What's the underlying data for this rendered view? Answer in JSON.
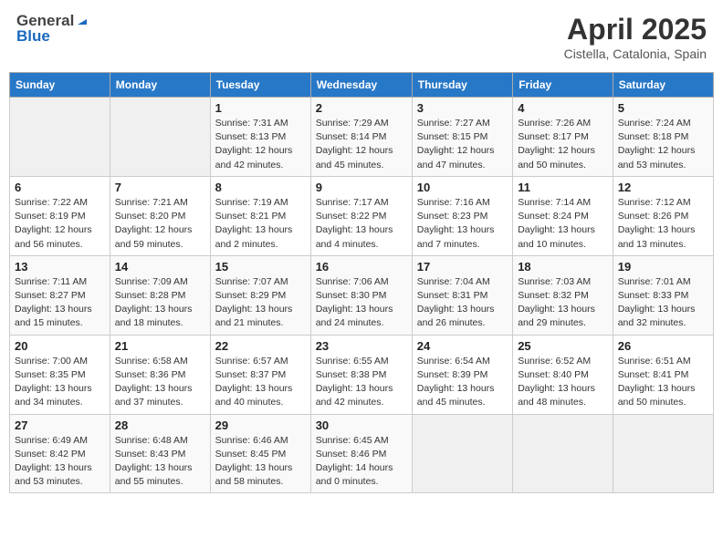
{
  "header": {
    "logo_general": "General",
    "logo_blue": "Blue",
    "title": "April 2025",
    "subtitle": "Cistella, Catalonia, Spain"
  },
  "weekdays": [
    "Sunday",
    "Monday",
    "Tuesday",
    "Wednesday",
    "Thursday",
    "Friday",
    "Saturday"
  ],
  "weeks": [
    [
      {
        "day": "",
        "sunrise": "",
        "sunset": "",
        "daylight": "",
        "empty": true
      },
      {
        "day": "",
        "sunrise": "",
        "sunset": "",
        "daylight": "",
        "empty": true
      },
      {
        "day": "1",
        "sunrise": "Sunrise: 7:31 AM",
        "sunset": "Sunset: 8:13 PM",
        "daylight": "Daylight: 12 hours and 42 minutes."
      },
      {
        "day": "2",
        "sunrise": "Sunrise: 7:29 AM",
        "sunset": "Sunset: 8:14 PM",
        "daylight": "Daylight: 12 hours and 45 minutes."
      },
      {
        "day": "3",
        "sunrise": "Sunrise: 7:27 AM",
        "sunset": "Sunset: 8:15 PM",
        "daylight": "Daylight: 12 hours and 47 minutes."
      },
      {
        "day": "4",
        "sunrise": "Sunrise: 7:26 AM",
        "sunset": "Sunset: 8:17 PM",
        "daylight": "Daylight: 12 hours and 50 minutes."
      },
      {
        "day": "5",
        "sunrise": "Sunrise: 7:24 AM",
        "sunset": "Sunset: 8:18 PM",
        "daylight": "Daylight: 12 hours and 53 minutes."
      }
    ],
    [
      {
        "day": "6",
        "sunrise": "Sunrise: 7:22 AM",
        "sunset": "Sunset: 8:19 PM",
        "daylight": "Daylight: 12 hours and 56 minutes."
      },
      {
        "day": "7",
        "sunrise": "Sunrise: 7:21 AM",
        "sunset": "Sunset: 8:20 PM",
        "daylight": "Daylight: 12 hours and 59 minutes."
      },
      {
        "day": "8",
        "sunrise": "Sunrise: 7:19 AM",
        "sunset": "Sunset: 8:21 PM",
        "daylight": "Daylight: 13 hours and 2 minutes."
      },
      {
        "day": "9",
        "sunrise": "Sunrise: 7:17 AM",
        "sunset": "Sunset: 8:22 PM",
        "daylight": "Daylight: 13 hours and 4 minutes."
      },
      {
        "day": "10",
        "sunrise": "Sunrise: 7:16 AM",
        "sunset": "Sunset: 8:23 PM",
        "daylight": "Daylight: 13 hours and 7 minutes."
      },
      {
        "day": "11",
        "sunrise": "Sunrise: 7:14 AM",
        "sunset": "Sunset: 8:24 PM",
        "daylight": "Daylight: 13 hours and 10 minutes."
      },
      {
        "day": "12",
        "sunrise": "Sunrise: 7:12 AM",
        "sunset": "Sunset: 8:26 PM",
        "daylight": "Daylight: 13 hours and 13 minutes."
      }
    ],
    [
      {
        "day": "13",
        "sunrise": "Sunrise: 7:11 AM",
        "sunset": "Sunset: 8:27 PM",
        "daylight": "Daylight: 13 hours and 15 minutes."
      },
      {
        "day": "14",
        "sunrise": "Sunrise: 7:09 AM",
        "sunset": "Sunset: 8:28 PM",
        "daylight": "Daylight: 13 hours and 18 minutes."
      },
      {
        "day": "15",
        "sunrise": "Sunrise: 7:07 AM",
        "sunset": "Sunset: 8:29 PM",
        "daylight": "Daylight: 13 hours and 21 minutes."
      },
      {
        "day": "16",
        "sunrise": "Sunrise: 7:06 AM",
        "sunset": "Sunset: 8:30 PM",
        "daylight": "Daylight: 13 hours and 24 minutes."
      },
      {
        "day": "17",
        "sunrise": "Sunrise: 7:04 AM",
        "sunset": "Sunset: 8:31 PM",
        "daylight": "Daylight: 13 hours and 26 minutes."
      },
      {
        "day": "18",
        "sunrise": "Sunrise: 7:03 AM",
        "sunset": "Sunset: 8:32 PM",
        "daylight": "Daylight: 13 hours and 29 minutes."
      },
      {
        "day": "19",
        "sunrise": "Sunrise: 7:01 AM",
        "sunset": "Sunset: 8:33 PM",
        "daylight": "Daylight: 13 hours and 32 minutes."
      }
    ],
    [
      {
        "day": "20",
        "sunrise": "Sunrise: 7:00 AM",
        "sunset": "Sunset: 8:35 PM",
        "daylight": "Daylight: 13 hours and 34 minutes."
      },
      {
        "day": "21",
        "sunrise": "Sunrise: 6:58 AM",
        "sunset": "Sunset: 8:36 PM",
        "daylight": "Daylight: 13 hours and 37 minutes."
      },
      {
        "day": "22",
        "sunrise": "Sunrise: 6:57 AM",
        "sunset": "Sunset: 8:37 PM",
        "daylight": "Daylight: 13 hours and 40 minutes."
      },
      {
        "day": "23",
        "sunrise": "Sunrise: 6:55 AM",
        "sunset": "Sunset: 8:38 PM",
        "daylight": "Daylight: 13 hours and 42 minutes."
      },
      {
        "day": "24",
        "sunrise": "Sunrise: 6:54 AM",
        "sunset": "Sunset: 8:39 PM",
        "daylight": "Daylight: 13 hours and 45 minutes."
      },
      {
        "day": "25",
        "sunrise": "Sunrise: 6:52 AM",
        "sunset": "Sunset: 8:40 PM",
        "daylight": "Daylight: 13 hours and 48 minutes."
      },
      {
        "day": "26",
        "sunrise": "Sunrise: 6:51 AM",
        "sunset": "Sunset: 8:41 PM",
        "daylight": "Daylight: 13 hours and 50 minutes."
      }
    ],
    [
      {
        "day": "27",
        "sunrise": "Sunrise: 6:49 AM",
        "sunset": "Sunset: 8:42 PM",
        "daylight": "Daylight: 13 hours and 53 minutes."
      },
      {
        "day": "28",
        "sunrise": "Sunrise: 6:48 AM",
        "sunset": "Sunset: 8:43 PM",
        "daylight": "Daylight: 13 hours and 55 minutes."
      },
      {
        "day": "29",
        "sunrise": "Sunrise: 6:46 AM",
        "sunset": "Sunset: 8:45 PM",
        "daylight": "Daylight: 13 hours and 58 minutes."
      },
      {
        "day": "30",
        "sunrise": "Sunrise: 6:45 AM",
        "sunset": "Sunset: 8:46 PM",
        "daylight": "Daylight: 14 hours and 0 minutes."
      },
      {
        "day": "",
        "sunrise": "",
        "sunset": "",
        "daylight": "",
        "empty": true
      },
      {
        "day": "",
        "sunrise": "",
        "sunset": "",
        "daylight": "",
        "empty": true
      },
      {
        "day": "",
        "sunrise": "",
        "sunset": "",
        "daylight": "",
        "empty": true
      }
    ]
  ]
}
